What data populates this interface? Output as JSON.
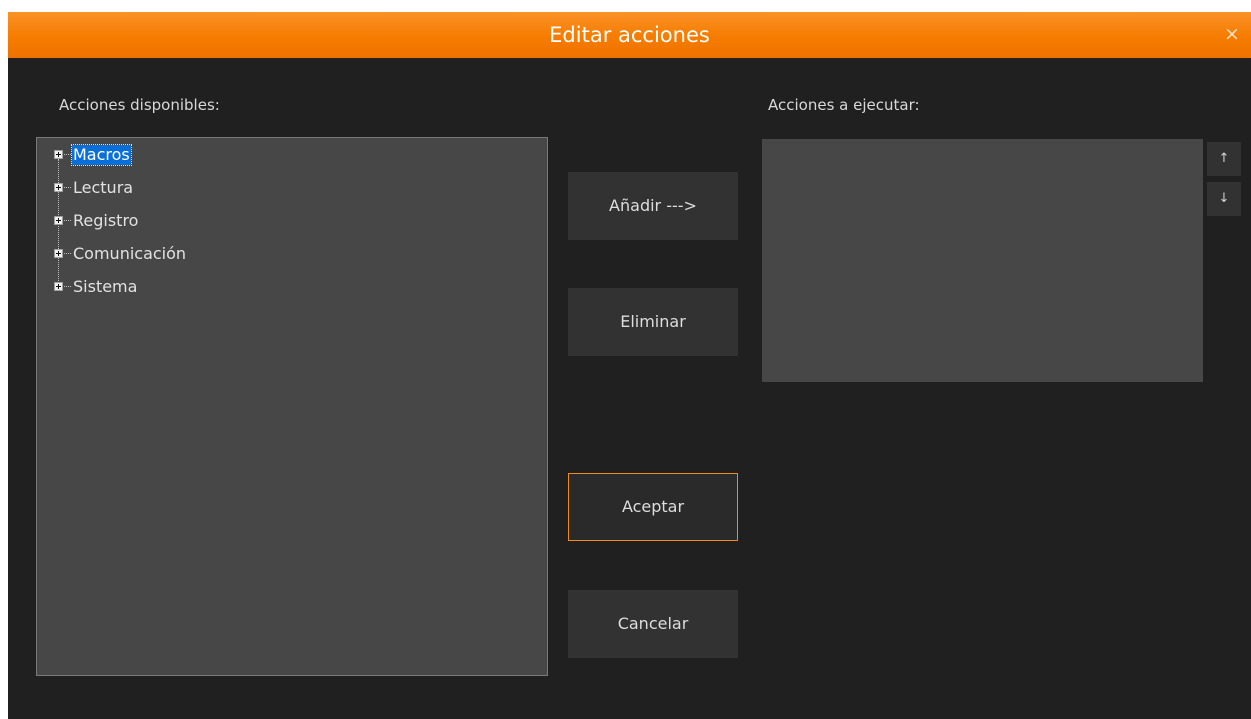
{
  "window": {
    "title": "Editar acciones",
    "close_glyph": "×",
    "accent_color": "#f57c00"
  },
  "available": {
    "label": "Acciones disponibles:",
    "items": [
      {
        "label": "Macros",
        "selected": true,
        "expander": "plus-box-icon"
      },
      {
        "label": "Lectura",
        "selected": false,
        "expander": "plus-box-icon"
      },
      {
        "label": "Registro",
        "selected": false,
        "expander": "plus-box-icon"
      },
      {
        "label": "Comunicación",
        "selected": false,
        "expander": "plus-box-icon"
      },
      {
        "label": "Sistema",
        "selected": false,
        "expander": "plus-box-icon"
      }
    ]
  },
  "execute": {
    "label": "Acciones a ejecutar:",
    "items": [],
    "move_up_glyph": "↑",
    "move_down_glyph": "↓"
  },
  "buttons": {
    "add": "Añadir --->",
    "remove": "Eliminar",
    "accept": "Aceptar",
    "cancel": "Cancelar"
  }
}
